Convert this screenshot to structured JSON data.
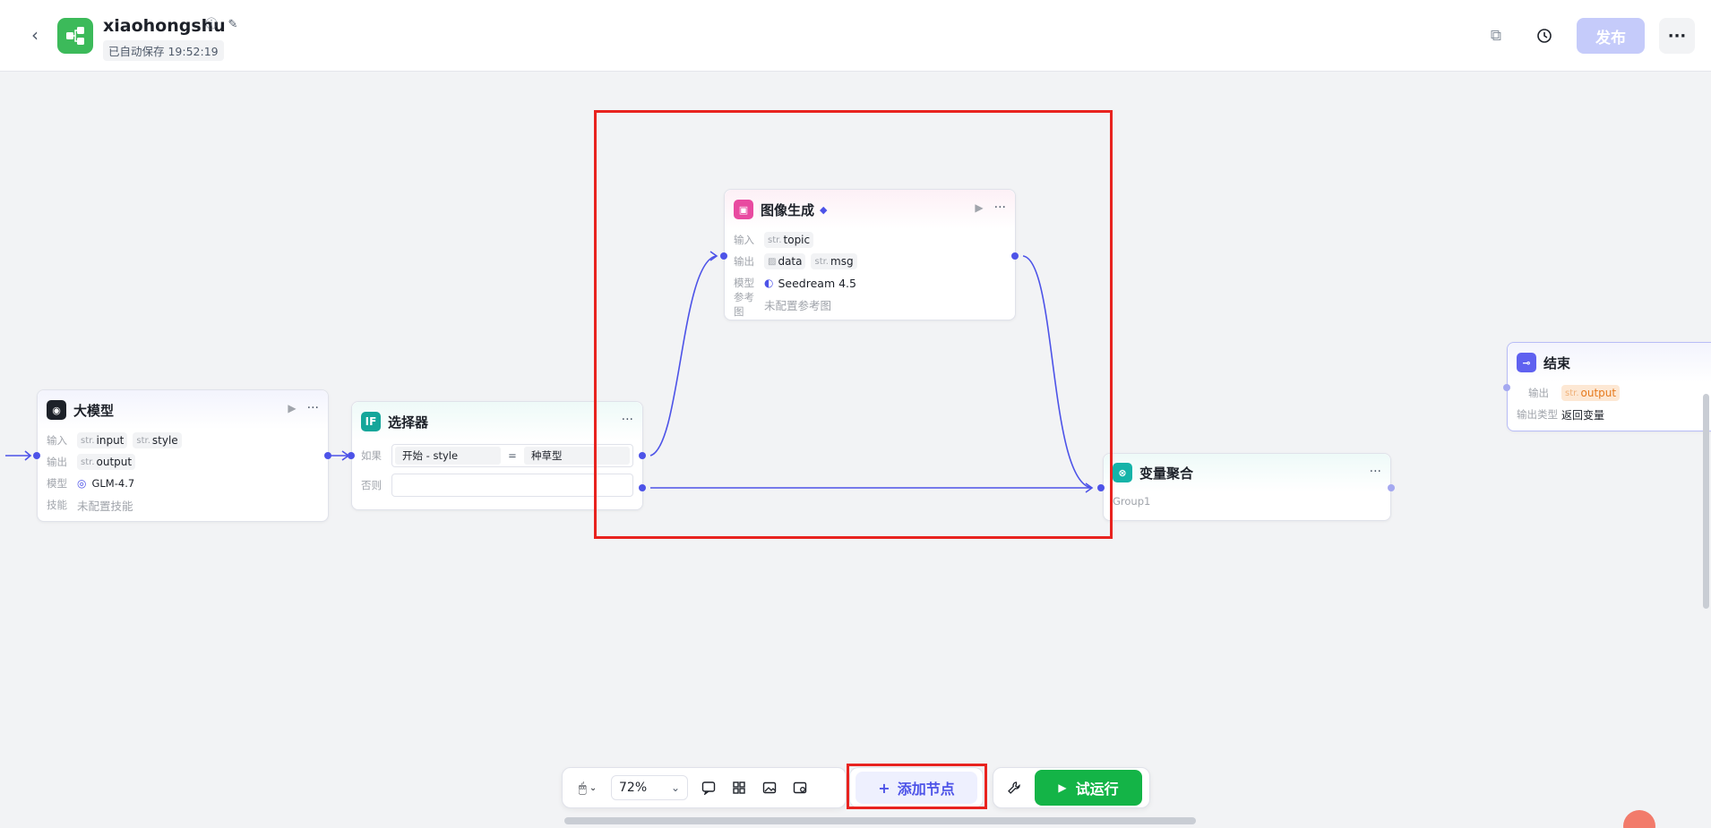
{
  "header": {
    "back_icon": "chevron-left-icon",
    "app_icon": "workflow-icon",
    "title": "xiaohongshu",
    "saved_text": "已自动保存 19:52:19",
    "publish_label": "发布",
    "more_label": "···"
  },
  "nodes": {
    "llm": {
      "title": "大模型",
      "input_label": "输入",
      "inputs": [
        {
          "type": "str.",
          "name": "input"
        },
        {
          "type": "str.",
          "name": "style"
        }
      ],
      "output_label": "输出",
      "outputs": [
        {
          "type": "str.",
          "name": "output"
        }
      ],
      "model_label": "模型",
      "model": "GLM-4.7",
      "skill_label": "技能",
      "skill": "未配置技能"
    },
    "selector": {
      "title": "选择器",
      "if_label": "如果",
      "else_label": "否则",
      "condition_left": "开始  -  style",
      "condition_op": "=",
      "condition_right": "种草型"
    },
    "image": {
      "title": "图像生成",
      "input_label": "输入",
      "inputs": [
        {
          "type": "str.",
          "name": "topic"
        }
      ],
      "output_label": "输出",
      "outputs": [
        {
          "type": "img",
          "name": "data"
        },
        {
          "type": "str.",
          "name": "msg"
        }
      ],
      "model_label": "模型",
      "model": "Seedream 4.5",
      "ref_label": "参考图",
      "ref": "未配置参考图"
    },
    "aggregate": {
      "title": "变量聚合",
      "group": "Group1"
    },
    "end": {
      "title": "结束",
      "output_label": "输出",
      "output": {
        "type": "str.",
        "name": "output"
      },
      "output_type_label": "输出类型",
      "output_type": "返回变量"
    }
  },
  "toolbar": {
    "zoom": "72%",
    "add_node_label": "添加节点",
    "try_run_label": "试运行"
  },
  "colors": {
    "accent": "#4d53e8",
    "publish": "#c5cbfa",
    "run": "#14b447",
    "highlight": "#e8231f"
  }
}
